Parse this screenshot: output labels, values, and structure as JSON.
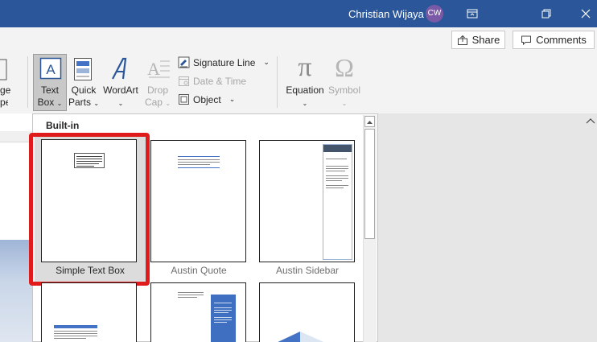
{
  "titlebar": {
    "user_name": "Christian Wijaya",
    "avatar_initials": "CW"
  },
  "ribbon": {
    "share_label": "Share",
    "comments_label": "Comments",
    "partial_left_top": "ge",
    "partial_left_bottom": "per",
    "textbox_top": "Text",
    "textbox_bottom": "Box",
    "quickparts_top": "Quick",
    "quickparts_bottom": "Parts",
    "wordart_label": "WordArt",
    "dropcap_top": "Drop",
    "dropcap_bottom": "Cap",
    "signature_line_label": "Signature Line",
    "date_time_label": "Date & Time",
    "object_label": "Object",
    "equation_label": "Equation",
    "symbol_label": "Symbol",
    "omega_glyph": "Ω",
    "pi_glyph": "π"
  },
  "gallery": {
    "section_title": "Built-in",
    "tiles": [
      {
        "label": "Simple Text Box"
      },
      {
        "label": "Austin Quote"
      },
      {
        "label": "Austin Sidebar"
      }
    ]
  },
  "colors": {
    "titlebar": "#2b579a",
    "highlight": "#e01b1b",
    "accent_blue": "#4472c4"
  }
}
